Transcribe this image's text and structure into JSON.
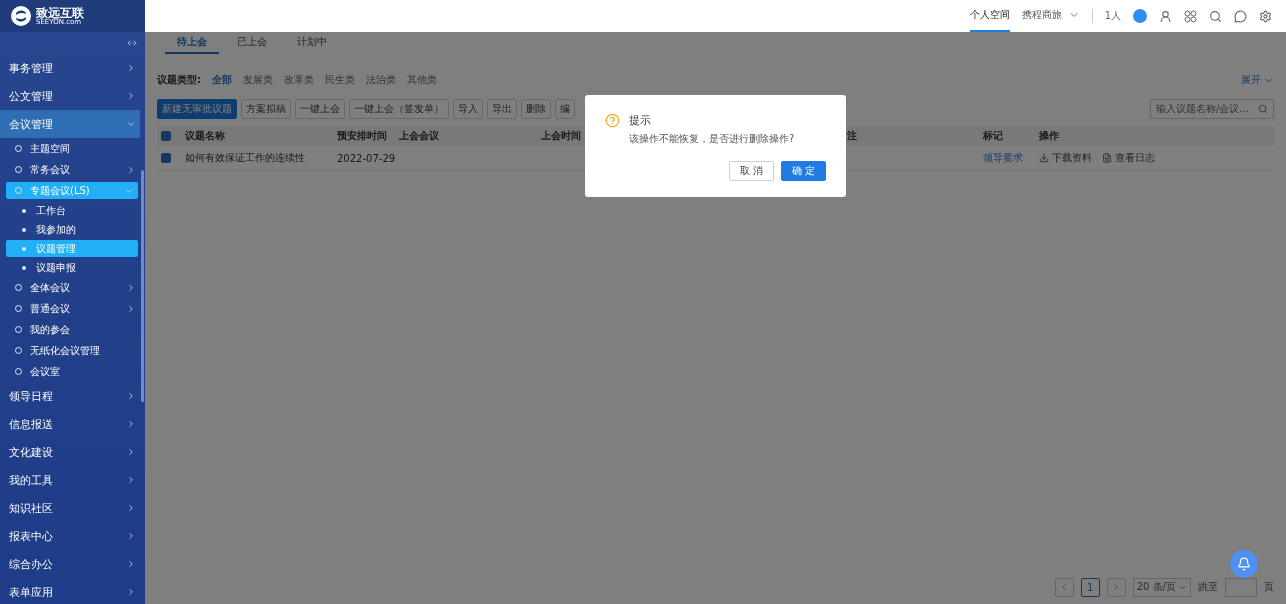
{
  "logo": {
    "name": "致远互联",
    "domain": "SEEYON.com"
  },
  "sidebar": {
    "items": [
      {
        "label": "事务管理",
        "expanded": false,
        "selected": false
      },
      {
        "label": "公文管理",
        "expanded": false,
        "selected": false
      },
      {
        "label": "会议管理",
        "expanded": true,
        "selected": true,
        "children": [
          {
            "label": "主题空间",
            "selected": false
          },
          {
            "label": "常务会议",
            "expanded": false,
            "selected": false
          },
          {
            "label": "专题会议(LS)",
            "expanded": true,
            "selected": true,
            "children": [
              {
                "label": "工作台",
                "selected": false
              },
              {
                "label": "我参加的",
                "selected": false
              },
              {
                "label": "议题管理",
                "selected": true
              },
              {
                "label": "议题申报",
                "selected": false
              }
            ]
          },
          {
            "label": "全体会议",
            "expanded": false,
            "selected": false
          },
          {
            "label": "普通会议",
            "expanded": false,
            "selected": false
          },
          {
            "label": "我的参会",
            "selected": false
          },
          {
            "label": "无纸化会议管理",
            "selected": false
          },
          {
            "label": "会议室",
            "selected": false
          }
        ]
      },
      {
        "label": "领导日程",
        "expanded": false,
        "selected": false
      },
      {
        "label": "信息报送",
        "expanded": false,
        "selected": false
      },
      {
        "label": "文化建设",
        "expanded": false,
        "selected": false
      },
      {
        "label": "我的工具",
        "expanded": false,
        "selected": false
      },
      {
        "label": "知识社区",
        "expanded": false,
        "selected": false
      },
      {
        "label": "报表中心",
        "expanded": false,
        "selected": false
      },
      {
        "label": "综合办公",
        "expanded": false,
        "selected": false
      },
      {
        "label": "表单应用",
        "expanded": false,
        "selected": false
      }
    ]
  },
  "header": {
    "tabs": [
      {
        "label": "个人空间",
        "selected": true
      },
      {
        "label": "携程商旅",
        "selected": false
      }
    ],
    "online_count": "1人"
  },
  "tabs": [
    {
      "label": "待上会",
      "selected": true
    },
    {
      "label": "已上会",
      "selected": false
    },
    {
      "label": "计划中",
      "selected": false
    }
  ],
  "filter": {
    "label": "议题类型:",
    "options": [
      {
        "label": "全部",
        "selected": true
      },
      {
        "label": "发展类",
        "selected": false
      },
      {
        "label": "改革类",
        "selected": false
      },
      {
        "label": "民生类",
        "selected": false
      },
      {
        "label": "法治类",
        "selected": false
      },
      {
        "label": "其他类",
        "selected": false
      }
    ],
    "expand": "展开"
  },
  "toolbar": {
    "buttons": [
      {
        "label": "新建无审批议题",
        "kind": "primary"
      },
      {
        "label": "方案拟稿",
        "kind": "default"
      },
      {
        "label": "一键上会",
        "kind": "default"
      },
      {
        "label": "一键上会（签发单）",
        "kind": "default"
      },
      {
        "label": "导入",
        "kind": "default"
      },
      {
        "label": "导出",
        "kind": "default"
      },
      {
        "label": "删除",
        "kind": "default"
      },
      {
        "label": "编",
        "kind": "default"
      }
    ],
    "search": {
      "placeholder": "输入议题名称/会议..."
    }
  },
  "table": {
    "all_checked": true,
    "columns": [
      "议题名称",
      "预安排时间",
      "上会会议",
      "上会时间",
      "注",
      "标记",
      "操作"
    ],
    "rows": [
      {
        "checked": true,
        "title": "如何有效保证工作的连续性",
        "date": "2022-07-29",
        "mark": "领导要求",
        "actions": [
          "下载资料",
          "查看日志"
        ]
      }
    ]
  },
  "pagination": {
    "pages": [
      {
        "label": "1",
        "selected": true
      }
    ],
    "page_size": "20 条/页",
    "jump_label": "跳至",
    "page_unit": "页"
  },
  "dialog": {
    "title": "提示",
    "message": "该操作不能恢复，是否进行删除操作?",
    "buttons": [
      {
        "label": "取 消",
        "kind": "default"
      },
      {
        "label": "确 定",
        "kind": "primary"
      }
    ]
  }
}
